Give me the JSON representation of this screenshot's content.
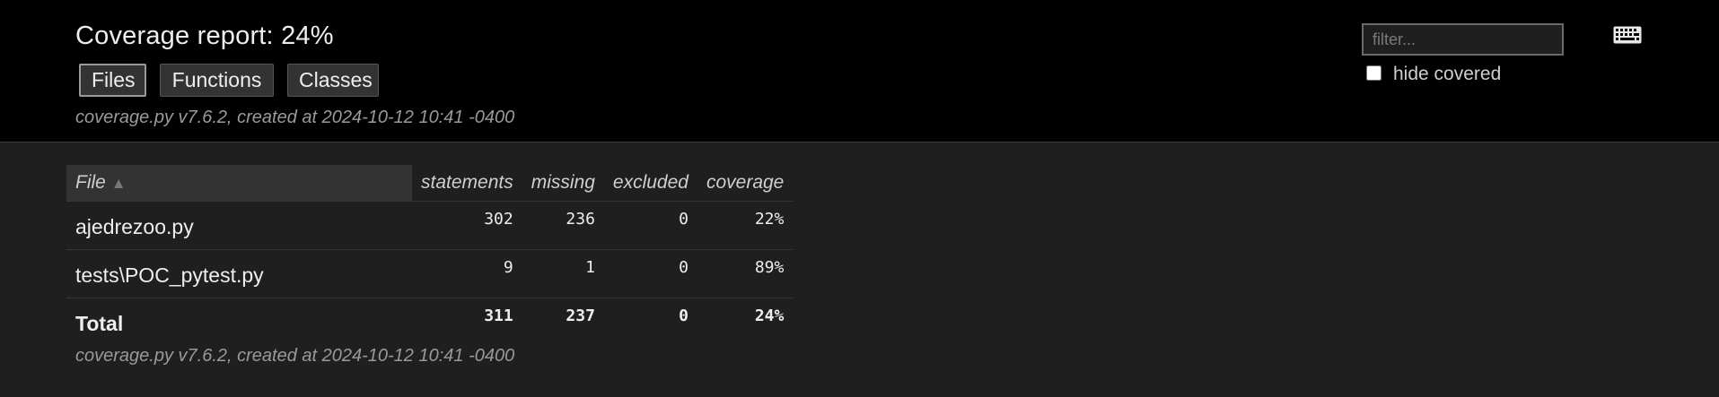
{
  "header": {
    "title": "Coverage report: 24%",
    "tabs": [
      {
        "label": "Files",
        "active": true
      },
      {
        "label": "Functions",
        "active": false
      },
      {
        "label": "Classes",
        "active": false
      }
    ],
    "created": "coverage.py v7.6.2, created at 2024-10-12 10:41 -0400"
  },
  "filter": {
    "placeholder": "filter...",
    "value": "",
    "hide_covered_label": "hide covered",
    "hide_covered_checked": false
  },
  "keyboard_icon": "keyboard-icon",
  "table": {
    "columns": {
      "file": "File",
      "sort_indicator": "▲",
      "statements": "statements",
      "missing": "missing",
      "excluded": "excluded",
      "coverage": "coverage"
    },
    "rows": [
      {
        "file": "ajedrezoo.py",
        "statements": "302",
        "missing": "236",
        "excluded": "0",
        "coverage": "22%"
      },
      {
        "file": "tests\\POC_pytest.py",
        "statements": "9",
        "missing": "1",
        "excluded": "0",
        "coverage": "89%"
      }
    ],
    "total": {
      "file": "Total",
      "statements": "311",
      "missing": "237",
      "excluded": "0",
      "coverage": "24%"
    }
  },
  "footer": {
    "created": "coverage.py v7.6.2, created at 2024-10-12 10:41 -0400"
  },
  "colors": {
    "header_bg": "#000000",
    "body_bg": "#1f1f1f",
    "text": "#eeeeee",
    "muted": "#9a9a9a"
  }
}
